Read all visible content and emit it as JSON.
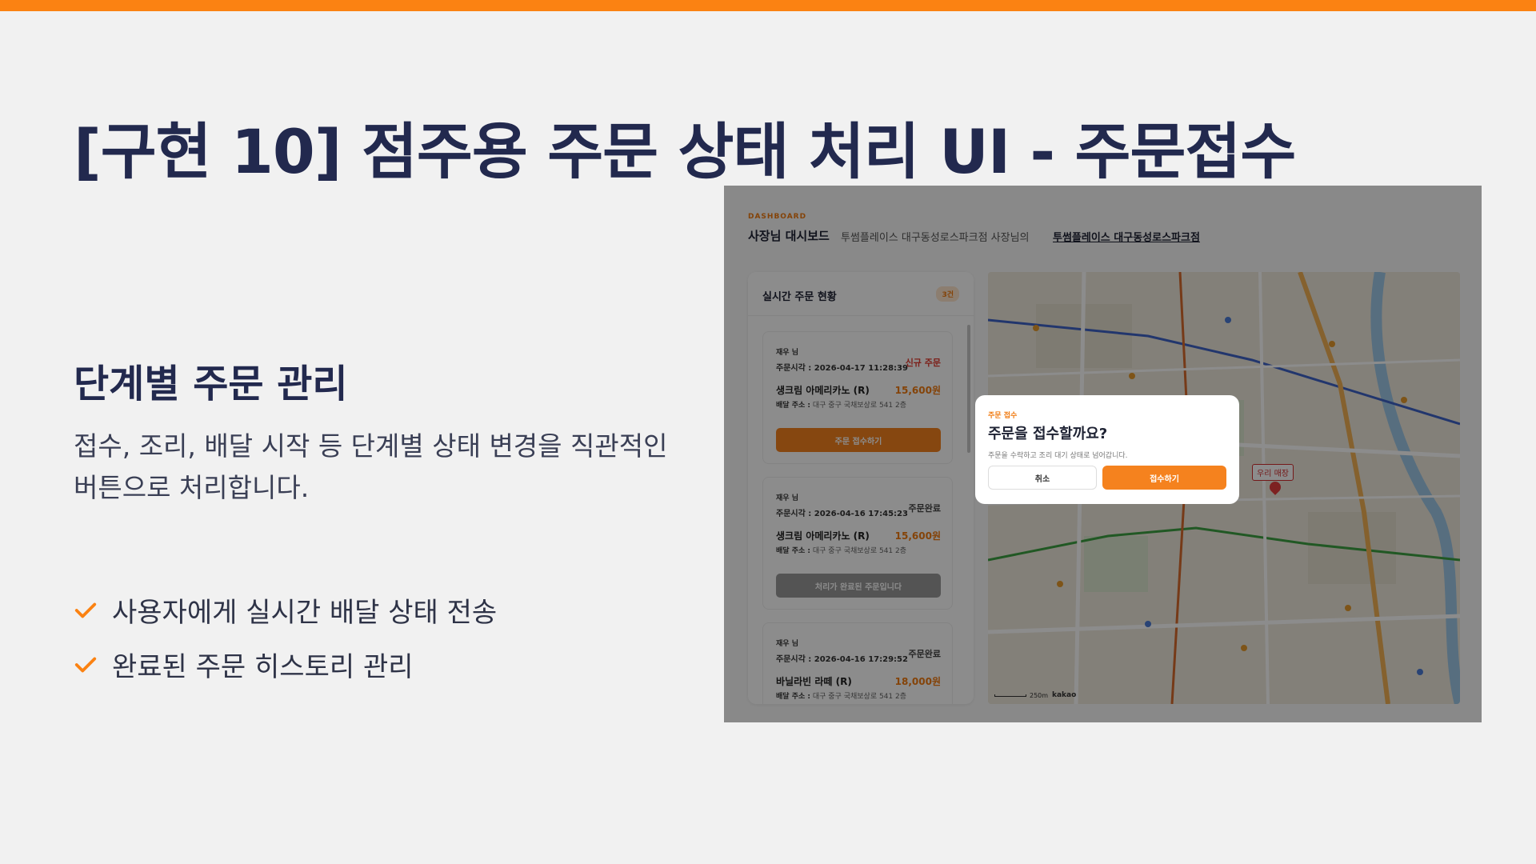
{
  "slide": {
    "title": "[구현 10] 점주용 주문 상태 처리 UI - 주문접수",
    "subtitle": "단계별 주문 관리",
    "description": "접수, 조리, 배달 시작 등 단계별 상태 변경을 직관적인 버튼으로 처리합니다.",
    "bullets": [
      "사용자에게 실시간 배달 상태 전송",
      "완료된 주문 히스토리 관리"
    ],
    "accent_color": "#fb8212",
    "title_color": "#22294e"
  },
  "dashboard": {
    "eyebrow": "DASHBOARD",
    "title": "사장님 대시보드",
    "subtitle": "투썸플레이스 대구동성로스파크점 사장님의",
    "store_link": "투썸플레이스 대구동성로스파크점"
  },
  "orders": {
    "heading": "실시간 주문 현황",
    "count": "3건",
    "items": [
      {
        "name": "재우 님",
        "time": "주문시각 : 2026-04-17 11:28:39",
        "status": "신규 주문",
        "menu": "생크림 아메리카노 (R)",
        "price": "15,600원",
        "addr_label": "배달 주소 :",
        "addr": "대구 중구 국채보상로 541 2층",
        "button": "주문 접수하기"
      },
      {
        "name": "재우 님",
        "time": "주문시각 : 2026-04-16 17:45:23",
        "status": "주문완료",
        "menu": "생크림 아메리카노 (R)",
        "price": "15,600원",
        "addr_label": "배달 주소 :",
        "addr": "대구 중구 국채보상로 541 2층",
        "button": "처리가 완료된 주문입니다"
      },
      {
        "name": "재우 님",
        "time": "주문시각 : 2026-04-16 17:29:52",
        "status": "주문완료",
        "menu": "바닐라빈 라떼 (R)",
        "price": "18,000원",
        "addr_label": "배달 주소 :",
        "addr": "대구 중구 국채보상로 541 2층"
      }
    ]
  },
  "map": {
    "pin_label": "우리 매장",
    "scale": "250m",
    "logo": "kakao"
  },
  "modal": {
    "eyebrow": "주문 접수",
    "title": "주문을 접수할까요?",
    "description": "주문을 수락하고 조리 대기 상태로 넘어갑니다.",
    "cancel": "취소",
    "accept": "접수하기"
  }
}
